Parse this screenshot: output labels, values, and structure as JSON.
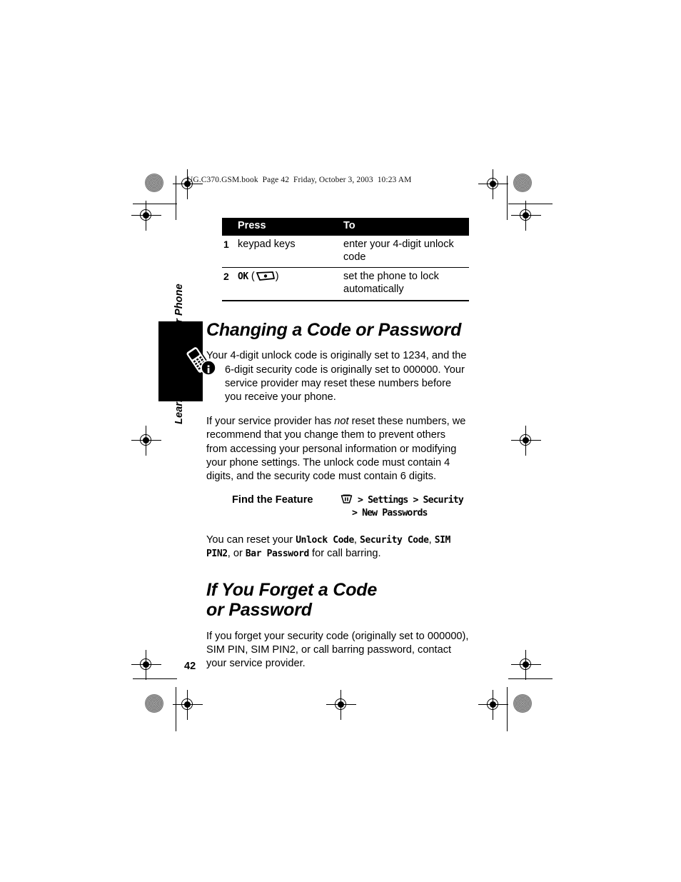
{
  "document": {
    "running_header": "UG.C370.GSM.book  Page 42  Friday, October 3, 2003  10:23 AM",
    "page_number": "42",
    "side_tab_label": "Learning to Use Your Phone"
  },
  "steps_table": {
    "headers": {
      "num": "",
      "press": "Press",
      "to": "To"
    },
    "rows": [
      {
        "num": "1",
        "press_text": "keypad keys",
        "press_key": "",
        "press_paren_open": "",
        "press_paren_close": "",
        "to": "enter your 4-digit unlock code"
      },
      {
        "num": "2",
        "press_text": "OK",
        "press_key": "center-select-key-icon",
        "press_paren_open": "(",
        "press_paren_close": ")",
        "to": "set the phone to lock automatically"
      }
    ]
  },
  "sections": [
    {
      "id": "changing-a-code-or-password",
      "heading": "Changing a Code or Password",
      "note": {
        "icon": "phone-info-icon",
        "line1": "Your 4-digit unlock code is originally set to 1234, and the",
        "rest": "6-digit security code is originally set to 000000. Your service provider may reset these numbers before you receive your phone."
      },
      "paragraph_1_part1": "If your service provider has ",
      "paragraph_1_italic": "not",
      "paragraph_1_part2": " reset these numbers, we recommend that you change them to prevent others from accessing your personal information or modifying your phone settings. The unlock code must contain 4 digits, and the security code must contain 6 digits.",
      "find_the_feature": {
        "label": "Find the Feature",
        "menu_icon": "menu-key-icon",
        "path_line_1": "> Settings > Security",
        "path_line_2": "> New Passwords"
      },
      "reset_sentence": {
        "part1": "You can reset your ",
        "item1": "Unlock Code",
        "sep1": ", ",
        "item2": "Security Code",
        "sep2": ", ",
        "item3": "SIM PIN2",
        "sep3": ", or ",
        "item4": "Bar Password",
        "part2": " for call barring."
      }
    },
    {
      "id": "if-you-forget-a-code-or-password",
      "heading": "If You Forget a Code or Password",
      "paragraph": "If you forget your security code (originally set to 000000), SIM PIN, SIM PIN2, or call barring password, contact your service provider."
    }
  ],
  "colors": {
    "page_background": "#ffffff",
    "text": "#000000",
    "table_header_background": "#000000",
    "table_header_text": "#ffffff",
    "margin_tab": "#000000"
  }
}
